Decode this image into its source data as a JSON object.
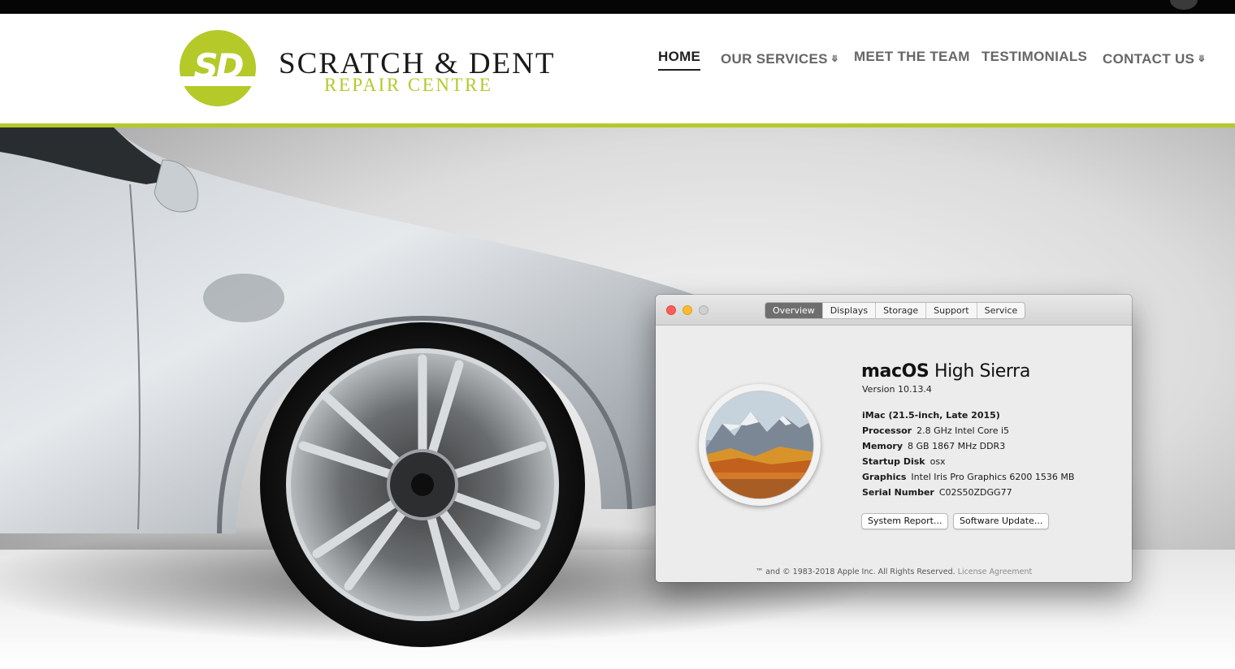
{
  "site": {
    "logo_letters": "SD",
    "logo_title": "SCRATCH & DENT",
    "logo_subtitle": "REPAIR CENTRE",
    "brand_color": "#b5c929",
    "nav": [
      {
        "label": "HOME",
        "active": true,
        "has_dropdown": false
      },
      {
        "label": "OUR SERVICES",
        "active": false,
        "has_dropdown": true
      },
      {
        "label": "MEET THE TEAM",
        "active": false,
        "has_dropdown": false
      },
      {
        "label": "TESTIMONIALS",
        "active": false,
        "has_dropdown": false
      },
      {
        "label": "CONTACT US",
        "active": false,
        "has_dropdown": true
      }
    ],
    "dropdown_icon": "chevron-double-down-icon",
    "hero_image": "silver-car-with-dented-fender"
  },
  "about_mac": {
    "tabs": [
      {
        "label": "Overview",
        "selected": true
      },
      {
        "label": "Displays",
        "selected": false
      },
      {
        "label": "Storage",
        "selected": false
      },
      {
        "label": "Support",
        "selected": false
      },
      {
        "label": "Service",
        "selected": false
      }
    ],
    "os_name_bold": "macOS",
    "os_name_rest": "High Sierra",
    "version": "Version 10.13.4",
    "model": "iMac (21.5-inch, Late 2015)",
    "specs": [
      {
        "label": "Processor",
        "value": "2.8 GHz Intel Core i5"
      },
      {
        "label": "Memory",
        "value": "8 GB 1867 MHz DDR3"
      },
      {
        "label": "Startup Disk",
        "value": "osx"
      },
      {
        "label": "Graphics",
        "value": "Intel Iris Pro Graphics 6200 1536 MB"
      },
      {
        "label": "Serial Number",
        "value": "C02S50ZDGG77"
      }
    ],
    "buttons": {
      "system_report": "System Report...",
      "software_update": "Software Update..."
    },
    "copyright": "™ and © 1983-2018 Apple Inc. All Rights Reserved.",
    "license_link": "License Agreement",
    "icon": "macos-high-sierra-icon"
  }
}
